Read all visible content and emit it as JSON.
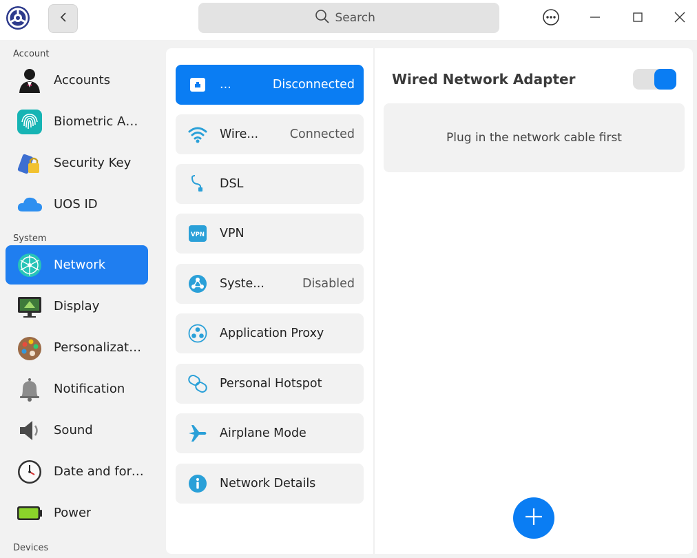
{
  "search": {
    "placeholder": "Search"
  },
  "sidebar": {
    "sections": {
      "account": "Account",
      "system": "System",
      "devices": "Devices"
    },
    "items": [
      {
        "label": "Accounts",
        "icon": "user-icon"
      },
      {
        "label": "Biometric Authentication",
        "icon": "fingerprint-icon"
      },
      {
        "label": "Security Key",
        "icon": "security-key-icon"
      },
      {
        "label": "UOS ID",
        "icon": "cloud-icon"
      },
      {
        "label": "Network",
        "icon": "network-icon",
        "active": true
      },
      {
        "label": "Display",
        "icon": "monitor-icon"
      },
      {
        "label": "Personalization",
        "icon": "palette-icon"
      },
      {
        "label": "Notification",
        "icon": "bell-icon"
      },
      {
        "label": "Sound",
        "icon": "speaker-icon"
      },
      {
        "label": "Date and format",
        "icon": "clock-icon"
      },
      {
        "label": "Power",
        "icon": "battery-icon"
      }
    ]
  },
  "network_list": [
    {
      "label": "...",
      "status": "Disconnected",
      "icon": "wired-icon",
      "active": true
    },
    {
      "label": "Wire...",
      "status": "Connected",
      "icon": "wifi-icon"
    },
    {
      "label": "DSL",
      "status": "",
      "icon": "dsl-icon"
    },
    {
      "label": "VPN",
      "status": "",
      "icon": "vpn-icon"
    },
    {
      "label": "Syste...",
      "status": "Disabled",
      "icon": "system-proxy-icon"
    },
    {
      "label": "Application Proxy",
      "status": "",
      "icon": "app-proxy-icon"
    },
    {
      "label": "Personal Hotspot",
      "status": "",
      "icon": "hotspot-icon"
    },
    {
      "label": "Airplane Mode",
      "status": "",
      "icon": "airplane-icon"
    },
    {
      "label": "Network Details",
      "status": "",
      "icon": "info-icon"
    }
  ],
  "detail": {
    "title": "Wired Network Adapter",
    "toggle_on": true,
    "message": "Plug in the network cable first"
  },
  "colors": {
    "accent": "#0a7df3",
    "icon_blue": "#2aa0d8"
  }
}
